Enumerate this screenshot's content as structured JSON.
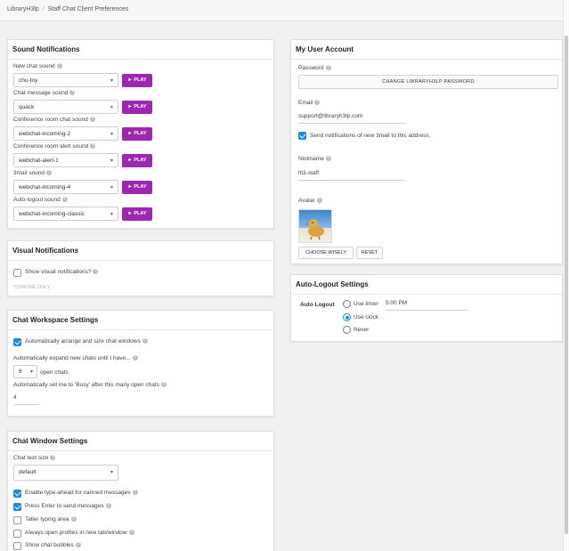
{
  "breadcrumb": {
    "root": "LibraryH3lp",
    "separator": "/",
    "current": "Staff Chat Client Preferences"
  },
  "sound": {
    "title": "Sound Notifications",
    "play_label": "► PLAY",
    "rows": [
      {
        "label": "New chat sound",
        "value": "chu-toy"
      },
      {
        "label": "Chat message sound",
        "value": "quack"
      },
      {
        "label": "Conference room chat sound",
        "value": "webchat-incoming-2"
      },
      {
        "label": "Conference room alert sound",
        "value": "webchat-alert-1"
      },
      {
        "label": "3mail sound",
        "value": "webchat-incoming-4"
      },
      {
        "label": "Auto-logout sound",
        "value": "webchat-incoming-classic"
      }
    ]
  },
  "visual": {
    "title": "Visual Notifications",
    "show_label": "Show visual notifications?",
    "show_checked": false,
    "note": "*CHROME ONLY"
  },
  "workspace": {
    "title": "Chat Workspace Settings",
    "auto_arrange_label": "Automatically arrange and size chat windows",
    "auto_arrange_checked": true,
    "expand_label": "Automatically expand new chats until I have...",
    "expand_value": "6",
    "expand_suffix": "open chats",
    "busy_label": "Automatically set me to 'Busy' after this many open chats",
    "busy_value": "4"
  },
  "window": {
    "title": "Chat Window Settings",
    "text_size_label": "Chat text size",
    "text_size_value": "default",
    "options": [
      {
        "label": "Enable type-ahead for canned messages",
        "checked": true,
        "help": true
      },
      {
        "label": "Press Enter to send messages",
        "checked": true,
        "help": true
      },
      {
        "label": "Taller typing area",
        "checked": false,
        "help": true
      },
      {
        "label": "Always open profiles in new tab/window",
        "checked": false,
        "help": true
      },
      {
        "label": "Show chat bubbles",
        "checked": false,
        "help": true
      }
    ]
  },
  "account": {
    "title": "My User Account",
    "password_label": "Password",
    "change_password_button": "CHANGE LIBRARYH3LP PASSWORD",
    "email_label": "Email",
    "email_value": "support@libraryh3lp.com",
    "send_notifications_label": "Send notifications of new 3mail to this address.",
    "send_notifications_checked": true,
    "nickname_label": "Nickname",
    "nickname_value": "lh3-staff",
    "avatar_label": "Avatar",
    "choose_button": "CHOOSE WISELY",
    "reset_button": "RESET"
  },
  "autologout": {
    "title": "Auto-Logout Settings",
    "label": "Auto Logout",
    "options": [
      {
        "label": "Use timer",
        "checked": false
      },
      {
        "label": "Use clock",
        "checked": true
      },
      {
        "label": "Never",
        "checked": false
      }
    ],
    "time_value": "5:00 PM"
  },
  "colors": {
    "accent_purple": "#9c27b0",
    "checkbox_blue": "#1e88e5"
  }
}
